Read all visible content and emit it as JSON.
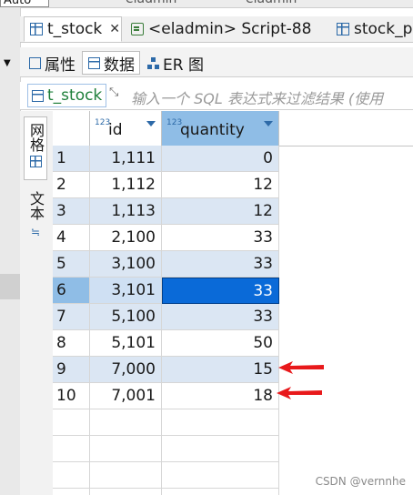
{
  "top_strip": {
    "auto_label": "Auto",
    "fragments": [
      "eladmin",
      "eladmin"
    ]
  },
  "editor_tabs": [
    {
      "label": "t_stock",
      "active": true,
      "icon": "table-icon",
      "closable": true
    },
    {
      "label": "<eladmin> Script-88",
      "active": false,
      "icon": "script-icon"
    },
    {
      "label": "stock_p",
      "active": false,
      "icon": "table-icon"
    }
  ],
  "sub_tabs": [
    {
      "label": "属性",
      "icon": "properties-icon",
      "active": false
    },
    {
      "label": "数据",
      "icon": "data-icon",
      "active": true
    },
    {
      "label": "ER 图",
      "icon": "er-diagram-icon",
      "active": false
    }
  ],
  "filter": {
    "table_name": "t_stock",
    "placeholder": "输入一个 SQL 表达式来过滤结果 (使用"
  },
  "side_tabs": {
    "grid": "网格",
    "text": "文本"
  },
  "grid": {
    "columns": [
      {
        "type_badge": "123",
        "name": "id"
      },
      {
        "type_badge": "123",
        "name": "quantity"
      }
    ],
    "rows": [
      {
        "num": "1",
        "id": "1,111",
        "quantity": "0"
      },
      {
        "num": "2",
        "id": "1,112",
        "quantity": "12"
      },
      {
        "num": "3",
        "id": "1,113",
        "quantity": "12"
      },
      {
        "num": "4",
        "id": "2,100",
        "quantity": "33"
      },
      {
        "num": "5",
        "id": "3,100",
        "quantity": "33"
      },
      {
        "num": "6",
        "id": "3,101",
        "quantity": "33"
      },
      {
        "num": "7",
        "id": "5,100",
        "quantity": "33"
      },
      {
        "num": "8",
        "id": "5,101",
        "quantity": "50"
      },
      {
        "num": "9",
        "id": "7,000",
        "quantity": "15"
      },
      {
        "num": "10",
        "id": "7,001",
        "quantity": "18"
      }
    ],
    "current_row": 6,
    "focused_cell": {
      "row": 6,
      "column": "quantity"
    },
    "arrow_rows": [
      9,
      10
    ]
  },
  "colors": {
    "row_alt": "#dbe6f3",
    "selected_header": "#8fbde6",
    "focus_cell": "#0a6ad8",
    "annotation_arrow": "#e8191b"
  },
  "watermark": "CSDN @vernnhe"
}
